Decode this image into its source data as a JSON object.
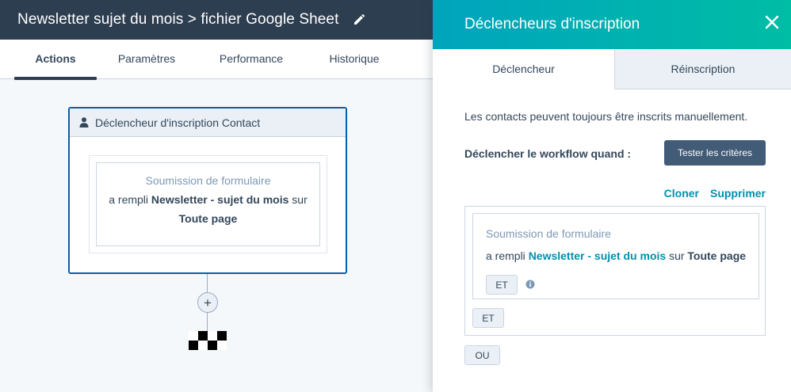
{
  "header": {
    "title": "Newsletter sujet du mois > fichier Google Sheet",
    "edit_icon": "pencil-icon"
  },
  "tabs": [
    {
      "label": "Actions",
      "active": true
    },
    {
      "label": "Paramètres",
      "active": false
    },
    {
      "label": "Performance",
      "active": false
    },
    {
      "label": "Historique",
      "active": false
    }
  ],
  "workflow": {
    "trigger_card": {
      "title": "Déclencheur d'inscription Contact",
      "icon": "user-icon",
      "filter_type": "Soumission de formulaire",
      "desc_prefix": "a rempli",
      "form_name": "Newsletter - sujet du mois",
      "desc_middle": "sur",
      "page": "Toute page"
    },
    "add_label": "+"
  },
  "panel": {
    "title": "Déclencheurs d'inscription",
    "tabs": [
      {
        "label": "Déclencheur",
        "active": true
      },
      {
        "label": "Réinscription",
        "active": false
      }
    ],
    "info_text": "Les contacts peuvent toujours être inscrits manuellement.",
    "when_label": "Déclencher le workflow quand :",
    "test_button": "Tester les critères",
    "clone_link": "Cloner",
    "delete_link": "Supprimer",
    "filter": {
      "type": "Soumission de formulaire",
      "prefix": "a rempli",
      "form_name": "Newsletter - sujet du mois",
      "middle": "sur",
      "page": "Toute page"
    },
    "and_inner": "ET",
    "and_outer": "ET",
    "or_label": "OU"
  },
  "colors": {
    "topbar": "#2d3e50",
    "panel_gradient_start": "#00a4bd",
    "panel_gradient_end": "#00bda5",
    "link": "#0091ae",
    "selected_border": "#0a5fa8"
  }
}
